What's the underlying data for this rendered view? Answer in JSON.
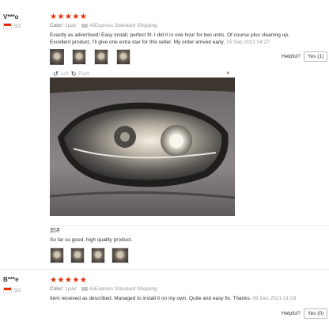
{
  "reviews": [
    {
      "user": "V***o",
      "country": "SG",
      "stars": "★★★★★",
      "color_label": "Color:",
      "color_value": "1pair",
      "shipping": "AliExpress Standard Shipping",
      "text": "Exactly as advertised! Easy install, perfect fit. I did it in one hour for two units. Of course plus cleaning up. Excellent product, I'll give one extra star for this seller. My order arrived early.",
      "date": "15 Sep 2021 04:27",
      "helpful_label": "Helpful?",
      "yes_label": "Yes (1)",
      "viewer": {
        "left_label": "Left",
        "right_label": "Right",
        "close": "×"
      },
      "additional_label": "追评",
      "additional_text": "So far so good, high quality product."
    },
    {
      "user": "B***e",
      "country": "SG",
      "stars": "★★★★★",
      "color_label": "Color:",
      "color_value": "1pair",
      "shipping": "AliExpress Standard Shipping",
      "text": "Item received as described. Managed to install it on my own. Quite and easy fix. Thanks.",
      "date": "06 Dec 2021 01:03",
      "helpful_label": "Helpful?",
      "yes_label": "Yes (0)"
    }
  ],
  "colors": {
    "star": "#e62e04",
    "text": "#333333",
    "muted": "#999999"
  }
}
